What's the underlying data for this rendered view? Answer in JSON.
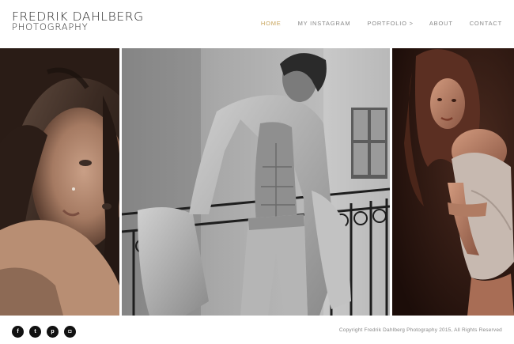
{
  "brand": {
    "name": "Fredrik Dahlberg",
    "subtitle": "Photography"
  },
  "nav": {
    "items": [
      {
        "label": "Home",
        "active": true
      },
      {
        "label": "My Instagram",
        "active": false
      },
      {
        "label": "Portfolio >",
        "active": false
      },
      {
        "label": "About",
        "active": false
      },
      {
        "label": "Contact",
        "active": false
      }
    ]
  },
  "gallery": {
    "photos": [
      {
        "description": "portrait-woman-closeup"
      },
      {
        "description": "man-denim-shirt-balcony"
      },
      {
        "description": "woman-off-shoulder-top"
      }
    ]
  },
  "footer": {
    "social": [
      {
        "icon": "facebook-icon",
        "glyph": "f"
      },
      {
        "icon": "twitter-icon",
        "glyph": "t"
      },
      {
        "icon": "pinterest-icon",
        "glyph": "p"
      },
      {
        "icon": "instagram-icon",
        "glyph": "◘"
      }
    ],
    "copyright": "Copyright Fredrik Dahlberg Photography 2015, All Rights Reserved"
  },
  "colors": {
    "accent": "#c8a45b",
    "nav_text": "#888888",
    "social_bg": "#111111"
  }
}
